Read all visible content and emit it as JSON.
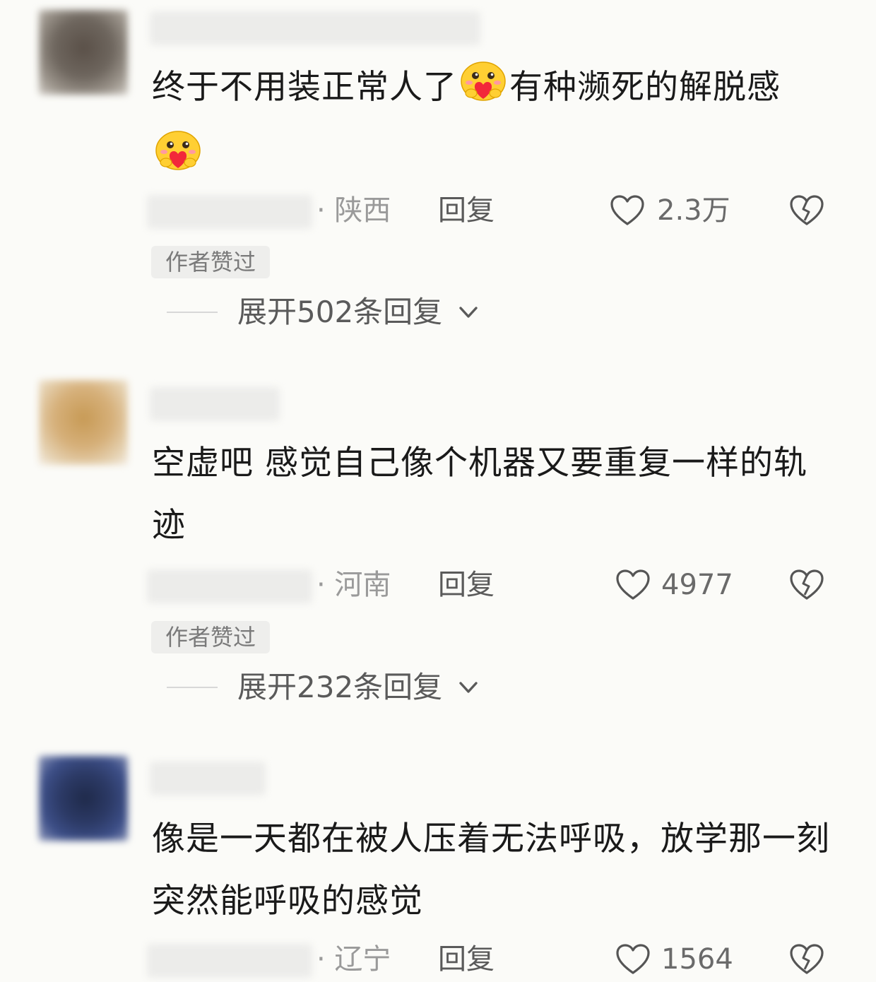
{
  "comments": [
    {
      "text_lines": [
        "终于不用装正常人了",
        "有种濒死的解脱感"
      ],
      "emoji": "hug-heart-emoji",
      "region": "· 陕西",
      "reply_label": "回复",
      "likes": "2.3万",
      "badge": "作者赞过",
      "expand": "展开502条回复"
    },
    {
      "text": "空虚吧 感觉自己像个机器又要重复一样的轨迹",
      "region": "· 河南",
      "reply_label": "回复",
      "likes": "4977",
      "badge": "作者赞过",
      "expand": "展开232条回复"
    },
    {
      "text": "像是一天都在被人压着无法呼吸，放学那一刻突然能呼吸的感觉",
      "region": "· 辽宁",
      "reply_label": "回复",
      "likes": "1564"
    }
  ],
  "colors": {
    "background": "#fbfbf8",
    "text": "#1a1a1a",
    "secondary": "#9a9a9a",
    "badge_bg": "#eeeeec"
  }
}
